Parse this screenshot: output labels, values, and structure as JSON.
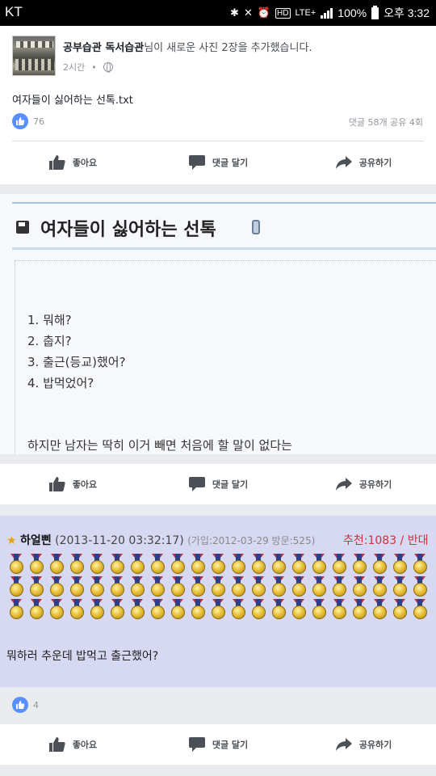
{
  "status_bar": {
    "carrier": "KT",
    "battery": "100%",
    "time": "오후 3:32",
    "network": "LTE+"
  },
  "post": {
    "author": "공부습관 독서습관",
    "action": "님이 새로운 사진 2장을 추가했습니다.",
    "time_ago": "2시간",
    "text": "여자들이 싫어하는 선톡.txt",
    "like_count": "76",
    "comments_shares": "댓글 58개 공유 4회"
  },
  "actions": {
    "like": "좋아요",
    "comment": "댓글 달기",
    "share": "공유하기"
  },
  "image1": {
    "title": "여자들이 싫어하는 선톡",
    "items": [
      "1. 뭐해?",
      "2. 춥지?",
      "3. 출근(등교)했어?",
      "4. 밥먹었어?"
    ],
    "footer": "하지만 남자는 딱히 이거 빼면 처음에 할 말이 없다는"
  },
  "image2": {
    "star": "★",
    "nickname": "하얼삔",
    "date": "(2013-11-20 03:32:17)",
    "joined": "(가입:2012-03-29 방문:525)",
    "recommend": "추천:1083 / 반대",
    "comment": "뭐하러 추운데 밥먹고 출근했어?",
    "medal_rows": 3,
    "medals_per_row": 21
  },
  "photo_likes": "4",
  "icons": {
    "like": "thumbs-up-icon",
    "comment": "speech-bubble-icon",
    "share": "share-arrow-icon",
    "privacy": "globe-icon"
  },
  "colors": {
    "facebook_blue": "#5890ff",
    "background": "#e9ebee"
  }
}
